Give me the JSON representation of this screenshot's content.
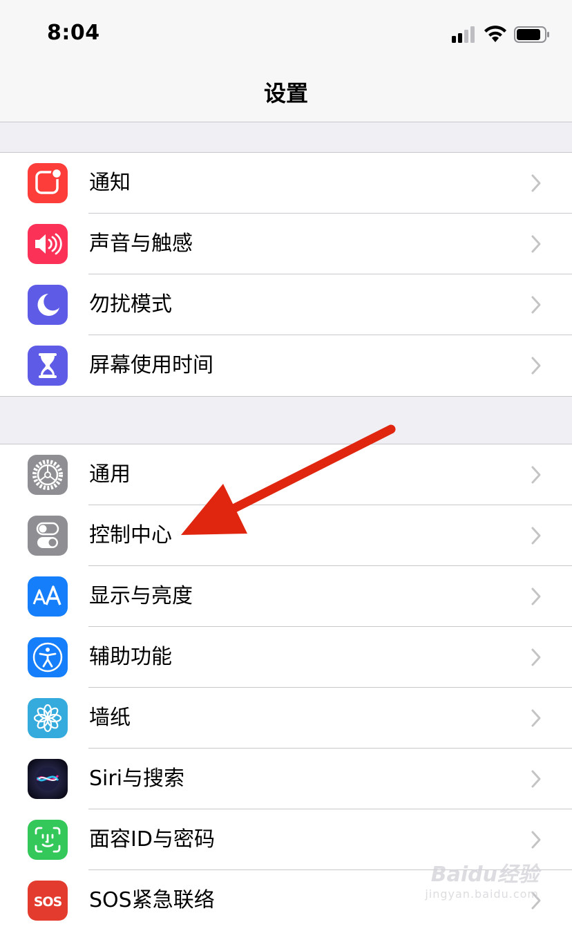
{
  "status_bar": {
    "time": "8:04",
    "icons": [
      "cellular-signal-icon",
      "wifi-icon",
      "battery-icon"
    ]
  },
  "nav": {
    "title": "设置"
  },
  "groups": [
    {
      "items": [
        {
          "label": "通知",
          "icon": "notifications-icon",
          "color": "#fc3d39"
        },
        {
          "label": "声音与触感",
          "icon": "sound-icon",
          "color": "#fc3158"
        },
        {
          "label": "勿扰模式",
          "icon": "moon-icon",
          "color": "#5e5ce6"
        },
        {
          "label": "屏幕使用时间",
          "icon": "hourglass-icon",
          "color": "#5e5ce6"
        }
      ]
    },
    {
      "items": [
        {
          "label": "通用",
          "icon": "gear-icon",
          "color": "#8e8e93"
        },
        {
          "label": "控制中心",
          "icon": "toggle-switches-icon",
          "color": "#8e8e93"
        },
        {
          "label": "显示与亮度",
          "icon": "text-size-icon",
          "color": "#147efb"
        },
        {
          "label": "辅助功能",
          "icon": "accessibility-icon",
          "color": "#147efb"
        },
        {
          "label": "墙纸",
          "icon": "flower-icon",
          "color": "#35aadc"
        },
        {
          "label": "Siri与搜索",
          "icon": "siri-icon",
          "color": "#1c1c3a"
        },
        {
          "label": "面容ID与密码",
          "icon": "face-id-icon",
          "color": "#34c759"
        },
        {
          "label": "SOS紧急联络",
          "icon": "sos-icon",
          "color": "#e33b2e"
        }
      ]
    }
  ],
  "annotation": {
    "type": "arrow",
    "color": "#e0260f",
    "target": "控制中心"
  },
  "watermark": {
    "text": "Baidu经验",
    "sub": "jingyan.baidu.com"
  },
  "colors": {
    "accent": "#147efb",
    "chevron": "#c4c4c7",
    "separator": "#c8c7cc",
    "background": "#efeff4"
  }
}
